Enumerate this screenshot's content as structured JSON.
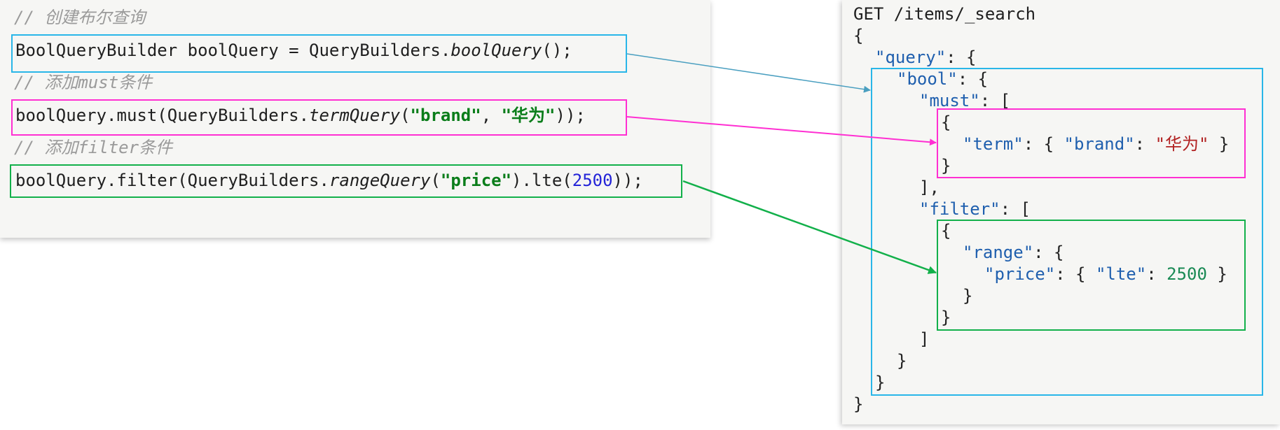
{
  "java": {
    "comment1": "// 创建布尔查询",
    "line1": {
      "pre": "BoolQueryBuilder boolQuery = QueryBuilders.",
      "method": "boolQuery",
      "post": "();"
    },
    "comment2": "// 添加must条件",
    "line2": {
      "pre": "boolQuery.must(QueryBuilders.",
      "method": "termQuery",
      "open": "(",
      "arg1": "\"brand\"",
      "sep": ", ",
      "arg2": "\"华为\"",
      "post": "));"
    },
    "comment3": "// 添加filter条件",
    "line3": {
      "pre": "boolQuery.filter(QueryBuilders.",
      "method": "rangeQuery",
      "open": "(",
      "arg1": "\"price\"",
      "mid": ").lte(",
      "num": "2500",
      "post": "));"
    }
  },
  "dsl": {
    "l1": "GET /items/_search",
    "l2": "{",
    "l3": {
      "key": "\"query\"",
      "rest": ": {"
    },
    "l4": {
      "key": "\"bool\"",
      "rest": ": {"
    },
    "l5": {
      "key": "\"must\"",
      "rest": ": ["
    },
    "l6": "{",
    "l7": {
      "key": "\"term\"",
      "mid1": ": { ",
      "key2": "\"brand\"",
      "mid2": ": ",
      "val": "\"华为\"",
      "end": " }"
    },
    "l8": "}",
    "l9": "],",
    "l10": {
      "key": "\"filter\"",
      "rest": ": ["
    },
    "l11": "{",
    "l12": {
      "key": "\"range\"",
      "rest": ": {"
    },
    "l13": {
      "key": "\"price\"",
      "mid1": ": { ",
      "key2": "\"lte\"",
      "mid2": ": ",
      "val": "2500",
      "end": " }"
    },
    "l14": "}",
    "l15": "}",
    "l16": "]",
    "l17": "}",
    "l18": "}",
    "l19": "}"
  },
  "colors": {
    "blue_box": "#29b6e8",
    "magenta_box": "#ff2fd2",
    "green_box": "#12b04a"
  }
}
